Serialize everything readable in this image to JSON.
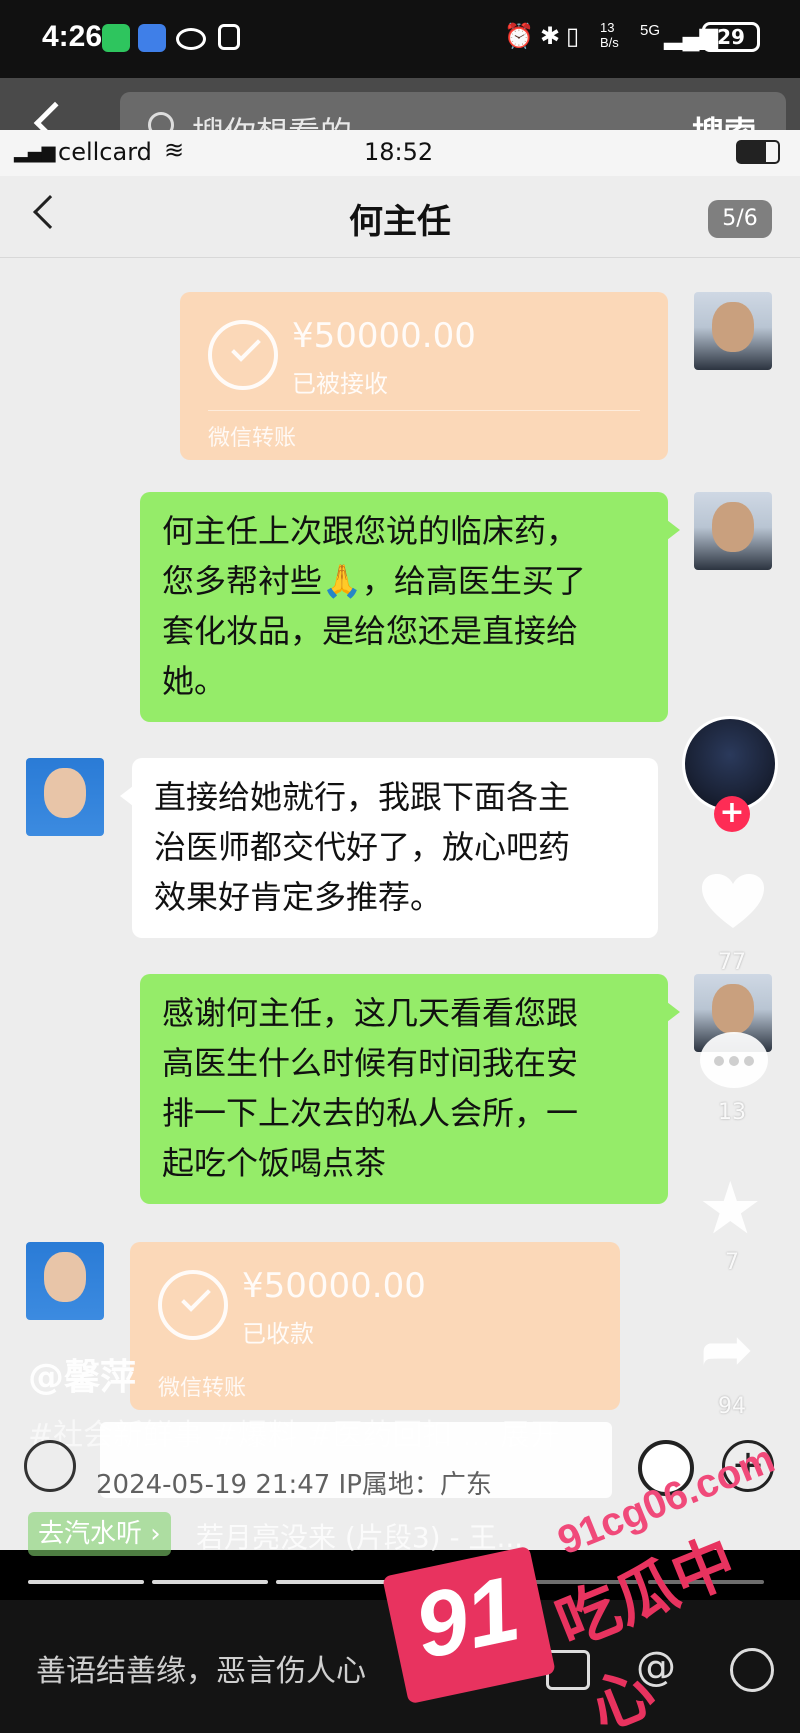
{
  "os_status": {
    "time": "4:26",
    "net_speed": "13 B/s",
    "net_type": "5G",
    "battery": "29"
  },
  "search": {
    "placeholder": "搜你想看的",
    "button": "搜索"
  },
  "screenshot": {
    "status": {
      "carrier": "cellcard",
      "time": "18:52"
    },
    "chat": {
      "title": "何主任",
      "page_indicator": "5/6",
      "messages": [
        {
          "type": "transfer",
          "sender": "me",
          "amount": "¥50000.00",
          "status": "已被接收",
          "footer": "微信转账"
        },
        {
          "type": "text",
          "sender": "me",
          "lines": [
            "何主任上次跟您说的临床药，",
            "您多帮衬些🙏，给高医生买了",
            "套化妆品，是给您还是直接给",
            "她。"
          ]
        },
        {
          "type": "text",
          "sender": "doctor",
          "lines": [
            "直接给她就行，我跟下面各主",
            "治医师都交代好了，放心吧药",
            "效果好肯定多推荐。"
          ]
        },
        {
          "type": "text",
          "sender": "me",
          "lines": [
            "感谢何主任，这几天看看您跟",
            "高医生什么时候有时间我在安",
            "排一下上次去的私人会所，一",
            "起吃个饭喝点茶"
          ]
        },
        {
          "type": "transfer",
          "sender": "doctor",
          "amount": "¥50000.00",
          "status": "已收款",
          "footer": "微信转账"
        }
      ]
    }
  },
  "video": {
    "author": "@馨萍",
    "tags": "#社会新鲜事 #爆料 #医药回扣 ... 展开",
    "meta": "2024-05-19 21:47  IP属地：广东",
    "music_badge": "去汽水听 ›",
    "music_title": "若月亮没来 (片段3) - 王...",
    "likes": "77",
    "comments": "13",
    "favorites": "7",
    "shares": "94"
  },
  "comment_bar": {
    "placeholder": "善语结善缘，恶言伤人心"
  },
  "watermark": {
    "number": "91",
    "site": "91cg06.com",
    "name": "吃瓜中心"
  },
  "colors": {
    "wechat_green": "#95ec69",
    "transfer_orange": "#fbd8b8",
    "follow_red": "#fe2c55",
    "watermark_pink": "#e8335f"
  }
}
